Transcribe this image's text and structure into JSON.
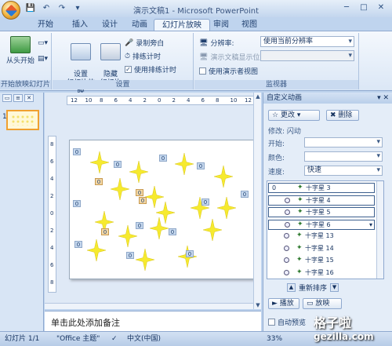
{
  "window": {
    "title": "演示文稿1 - Microsoft PowerPoint"
  },
  "tabs": [
    {
      "label": "开始"
    },
    {
      "label": "插入"
    },
    {
      "label": "设计"
    },
    {
      "label": "动画"
    },
    {
      "label": "幻灯片放映",
      "active": true
    },
    {
      "label": "审阅"
    },
    {
      "label": "视图"
    }
  ],
  "ribbon": {
    "group1": {
      "label": "开始放映幻灯片",
      "from_start": "从头开始"
    },
    "group2": {
      "label": "设置",
      "setup_show": "设置\n幻灯片放映",
      "hide_slide": "隐藏\n幻灯片",
      "record_narration": "录制旁白",
      "rehearse_timings": "排练计时",
      "use_rehearsed": "使用排练计时"
    },
    "group3": {
      "label": "监视器",
      "resolution_label": "分辨率:",
      "resolution_value": "使用当前分辨率",
      "show_on_label": "演示文稿显示位置:",
      "presenter_view": "使用演示者视图"
    }
  },
  "notes": {
    "placeholder": "单击此处添加备注"
  },
  "ruler": {
    "h": [
      "12",
      "10",
      "8",
      "6",
      "4",
      "2",
      "0",
      "2",
      "4",
      "6",
      "8",
      "10",
      "12"
    ],
    "v": [
      "8",
      "6",
      "4",
      "2",
      "0",
      "2",
      "4",
      "6",
      "8"
    ]
  },
  "slide": {
    "tags": [
      "0",
      "0",
      "0",
      "0",
      "0",
      "0",
      "0",
      "0",
      "0",
      "0",
      "0",
      "0",
      "0",
      "0",
      "0",
      "0"
    ]
  },
  "taskpane": {
    "title": "自定义动画",
    "change_btn": "更改",
    "delete_btn": "删除",
    "modify_label": "修改: 闪动",
    "start_label": "开始:",
    "color_label": "颜色:",
    "speed_label": "速度:",
    "speed_value": "快速",
    "items": [
      {
        "num": "0",
        "label": "十字星 3"
      },
      {
        "num": "",
        "label": "十字星 4"
      },
      {
        "num": "",
        "label": "十字星 5"
      },
      {
        "num": "",
        "label": "十字星 6"
      },
      {
        "num": "",
        "label": "十字星 13"
      },
      {
        "num": "",
        "label": "十字星 14"
      },
      {
        "num": "",
        "label": "十字星 15"
      },
      {
        "num": "",
        "label": "十字星 16"
      }
    ],
    "reorder_label": "重新排序",
    "autopreview": "自动预览"
  },
  "status": {
    "slide_count": "幻灯片 1/1",
    "theme": "\"Office 主题\"",
    "language": "中文(中国)",
    "zoom": "33%"
  },
  "watermark": {
    "main": "格子啦",
    "sub": "gezilla.com"
  }
}
